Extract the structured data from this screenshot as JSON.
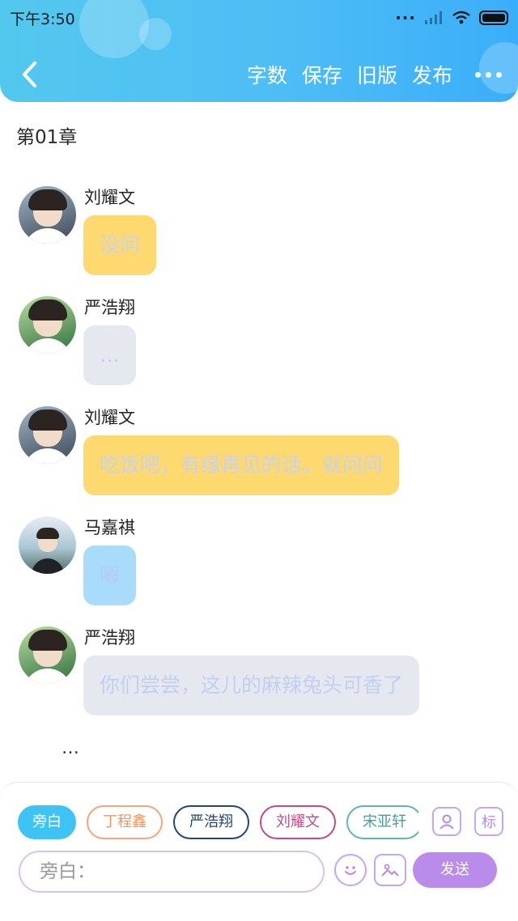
{
  "status_bar": {
    "time": "下午3:50"
  },
  "header": {
    "toolbar": [
      {
        "label": "字数"
      },
      {
        "label": "保存"
      },
      {
        "label": "旧版"
      },
      {
        "label": "发布"
      }
    ],
    "colors": {
      "gradient_start": "#53c8ee",
      "gradient_end": "#3aaef9"
    }
  },
  "chapter": {
    "title": "第01章"
  },
  "messages": [
    {
      "name": "刘耀文",
      "text": "没问",
      "bubble_color": "#fdd96f",
      "avatar": "avatar-a"
    },
    {
      "name": "严浩翔",
      "text": "…",
      "bubble_color": "#e5e9ef",
      "avatar": "avatar-b"
    },
    {
      "name": "刘耀文",
      "text": "吃饭吧，有缘再见的话，就问问",
      "bubble_color": "#fdd96f",
      "avatar": "avatar-a"
    },
    {
      "name": "马嘉祺",
      "text": "嗯",
      "bubble_color": "#a9dcfb",
      "avatar": "avatar-c"
    },
    {
      "name": "严浩翔",
      "text": "你们尝尝，这儿的麻辣兔头可香了",
      "bubble_color": "#e5e9ef",
      "avatar": "avatar-b"
    }
  ],
  "trailing_ellipsis": "…",
  "composer": {
    "characters": [
      {
        "label": "旁白",
        "selected": true
      },
      {
        "label": "丁程鑫"
      },
      {
        "label": "严浩翔"
      },
      {
        "label": "刘耀文"
      },
      {
        "label": "宋亚轩"
      }
    ],
    "tag_icon_label": "标",
    "input_placeholder": "旁白：",
    "send_label": "发送",
    "accent_color": "#b98ceb"
  }
}
